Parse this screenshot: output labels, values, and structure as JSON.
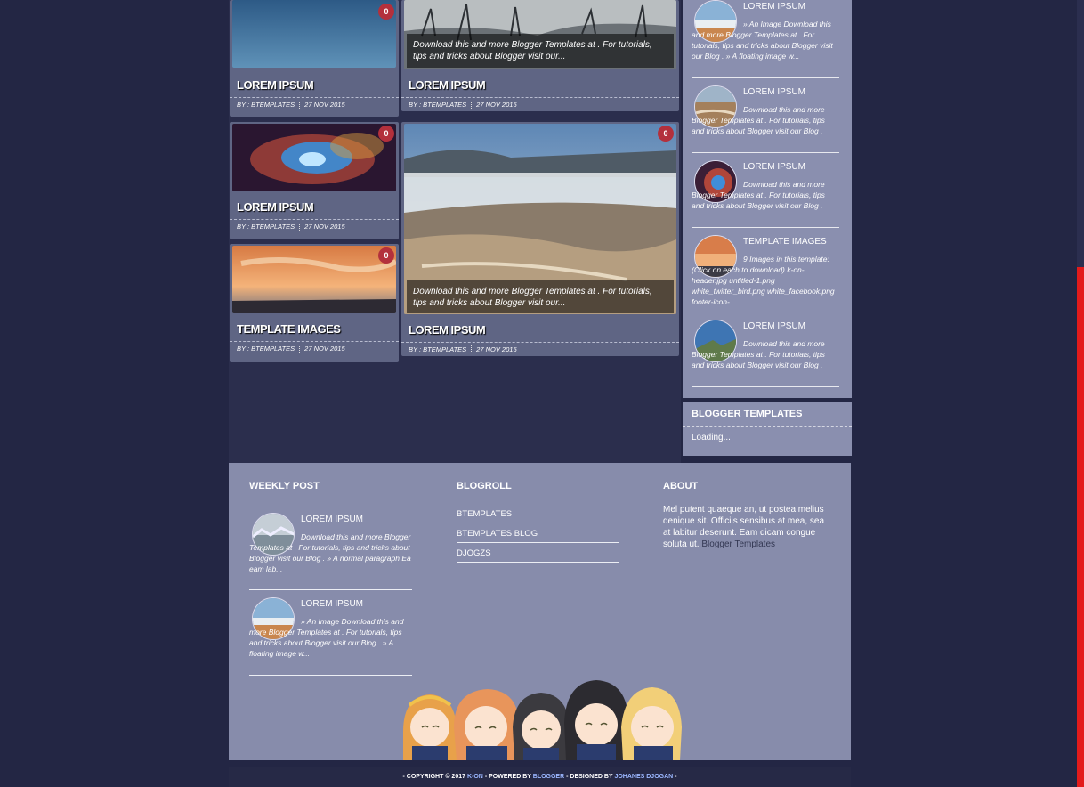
{
  "posts": [
    {
      "title": "LOREM IPSUM",
      "author": "BY : BTEMPLATES",
      "date": "27  NOV  2015",
      "comments": "0"
    },
    {
      "title": "LOREM IPSUM",
      "author": "BY : BTEMPLATES",
      "date": "27  NOV  2015",
      "excerpt": "Download this and more Blogger Templates at . For tutorials, tips and tricks about Blogger visit our..."
    },
    {
      "title": "LOREM IPSUM",
      "author": "BY : BTEMPLATES",
      "date": "27  NOV  2015",
      "comments": "0"
    },
    {
      "title": "LOREM IPSUM",
      "author": "BY : BTEMPLATES",
      "date": "27  NOV  2015",
      "comments": "0",
      "excerpt": "Download this and more Blogger Templates at . For tutorials, tips and tricks about Blogger visit our..."
    },
    {
      "title": "TEMPLATE IMAGES",
      "author": "BY : BTEMPLATES",
      "date": "27  NOV  2015",
      "comments": "0"
    }
  ],
  "sidebar": {
    "items": [
      {
        "title": "LOREM IPSUM",
        "text": "» An Image Download this and more Blogger Templates at . For tutorials, tips and tricks about Blogger visit our Blog . » A floating image w..."
      },
      {
        "title": "LOREM IPSUM",
        "text": "Download this and more Blogger Templates at . For tutorials, tips and tricks about Blogger visit our Blog ."
      },
      {
        "title": "LOREM IPSUM",
        "text": "Download this and more Blogger Templates at . For tutorials, tips and tricks about Blogger visit our Blog ."
      },
      {
        "title": "TEMPLATE IMAGES",
        "text": "9 Images in this template: (Click on each to download) k-on-header.jpg untitled-1.png white_twitter_bird.png white_facebook.png footer-icon-..."
      },
      {
        "title": "LOREM IPSUM",
        "text": "Download this and more Blogger Templates at . For tutorials, tips and tricks about Blogger visit our Blog ."
      }
    ],
    "blogger_templates": {
      "heading": "BLOGGER TEMPLATES",
      "status": "Loading..."
    }
  },
  "footer": {
    "weekly": {
      "heading": "WEEKLY POST",
      "items": [
        {
          "title": "LOREM IPSUM",
          "text": "Download this and more Blogger Templates at . For tutorials, tips and tricks about Blogger visit our Blog . » A normal paragraph Ea eam lab..."
        },
        {
          "title": "LOREM IPSUM",
          "text": "» An Image Download this and more Blogger Templates at . For tutorials, tips and tricks about Blogger visit our Blog . » A floating image w..."
        }
      ]
    },
    "blogroll": {
      "heading": "BLOGROLL",
      "links": [
        "BTEMPLATES",
        "BTEMPLATES BLOG",
        "DJOGZS"
      ]
    },
    "about": {
      "heading": "ABOUT",
      "text": "Mel putent quaeque an, ut postea melius denique sit. Officiis sensibus at mea, sea at labitur deserunt. Eam dicam congue soluta ut.",
      "link": "Blogger Templates"
    }
  },
  "copyright": {
    "prefix": "- COPYRIGHT © 2017",
    "site": "K-ON",
    "mid1": "- POWERED BY",
    "blogger": "BLOGGER",
    "mid2": "- DESIGNED BY",
    "designer": "JOHANES DJOGAN",
    "suffix": "-"
  },
  "colors": {
    "background": "#232644",
    "panel": "#8a8faf",
    "card": "#5f6584",
    "badge": "#b3303c",
    "scrollbar": "#e31b1b"
  }
}
